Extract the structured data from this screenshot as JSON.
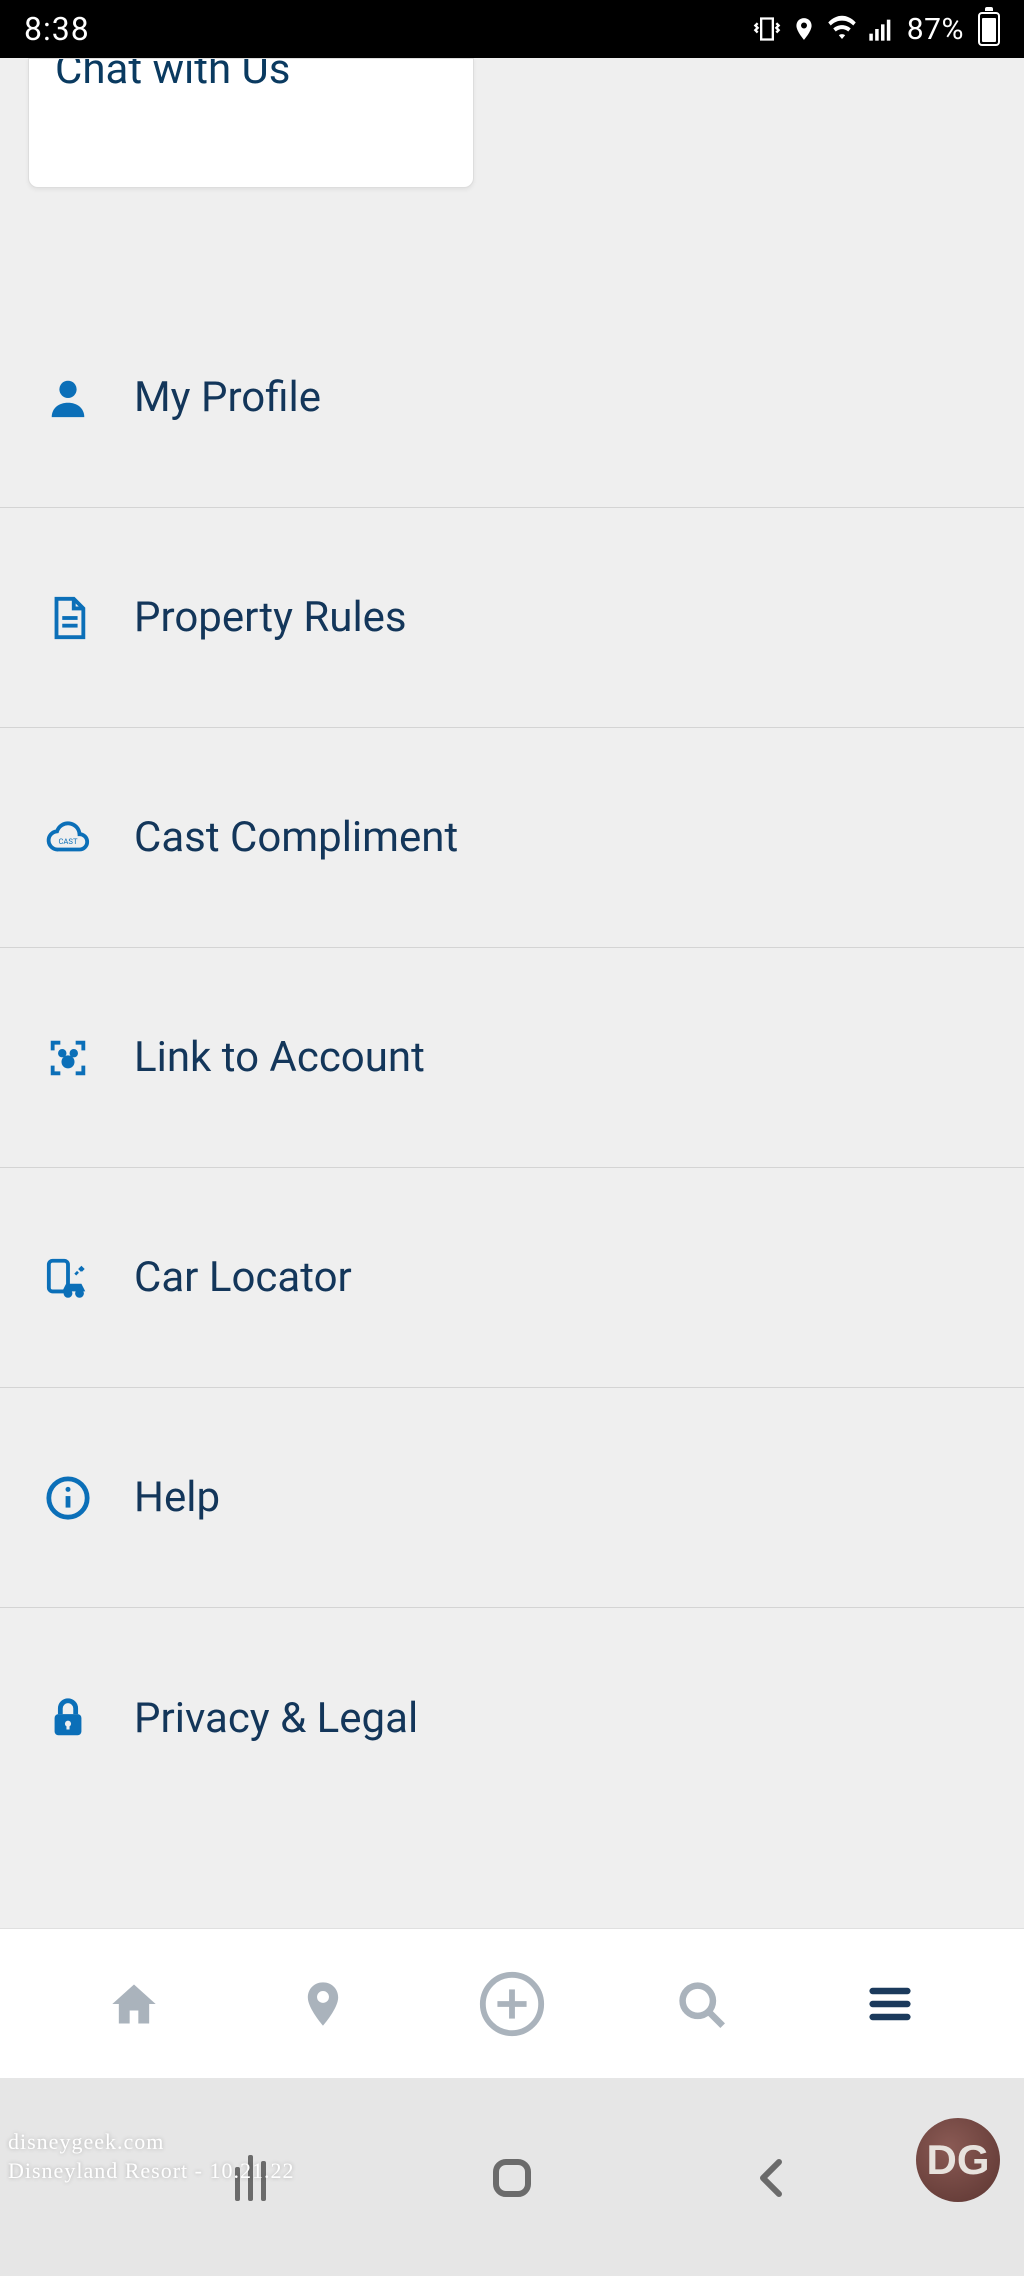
{
  "status": {
    "time": "8:38",
    "battery": "87%"
  },
  "card": {
    "chat_label": "Chat with Us"
  },
  "menu": {
    "items": [
      {
        "label": "My Profile"
      },
      {
        "label": "Property Rules"
      },
      {
        "label": "Cast Compliment"
      },
      {
        "label": "Link to Account"
      },
      {
        "label": "Car Locator"
      },
      {
        "label": "Help"
      },
      {
        "label": "Privacy & Legal"
      }
    ]
  },
  "watermark": {
    "line1": "disneygeek.com",
    "line2": "Disneyland Resort - 10.21.22"
  },
  "colors": {
    "accent": "#0b6fb8",
    "text": "#13365a"
  }
}
